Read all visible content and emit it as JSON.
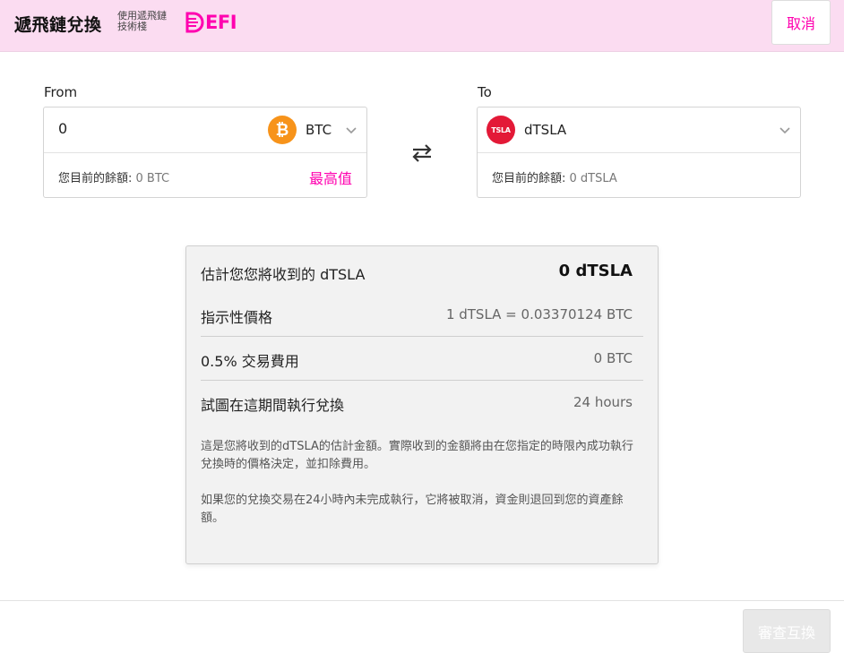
{
  "header": {
    "title": "遞飛鏈兌換",
    "powered_line1": "使用遞飛鏈",
    "powered_line2": "技術棧",
    "logo_text": "EFI",
    "cancel_label": "取消",
    "accent_color": "#ff00af",
    "background_color": "#fbdcf1"
  },
  "from": {
    "label": "From",
    "amount_value": "0",
    "token": "BTC",
    "token_icon": "bitcoin-icon",
    "balance_label": "您目前的餘額:",
    "balance_value": "0 BTC",
    "max_label": "最高值"
  },
  "to": {
    "label": "To",
    "token": "dTSLA",
    "token_icon_text": "TSLA",
    "balance_label": "您目前的餘額:",
    "balance_value": "0 dTSLA"
  },
  "summary": {
    "estimate_label": "估計您您將收到的 dTSLA",
    "estimate_value": "0 dTSLA",
    "price_label": "指示性價格",
    "price_value": "1 dTSLA = 0.03370124 BTC",
    "fee_label": "0.5% 交易費用",
    "fee_value": "0 BTC",
    "period_label": "試圖在這期間執行兌換",
    "period_value": "24 hours",
    "note1": "這是您將收到的dTSLA的估計金額。實際收到的金額將由在您指定的時限內成功執行兌換時的價格決定，並扣除費用。",
    "note2": "如果您的兌換交易在24小時內未完成執行，它將被取消，資金則退回到您的資產餘額。"
  },
  "footer": {
    "review_label": "審查互換"
  }
}
